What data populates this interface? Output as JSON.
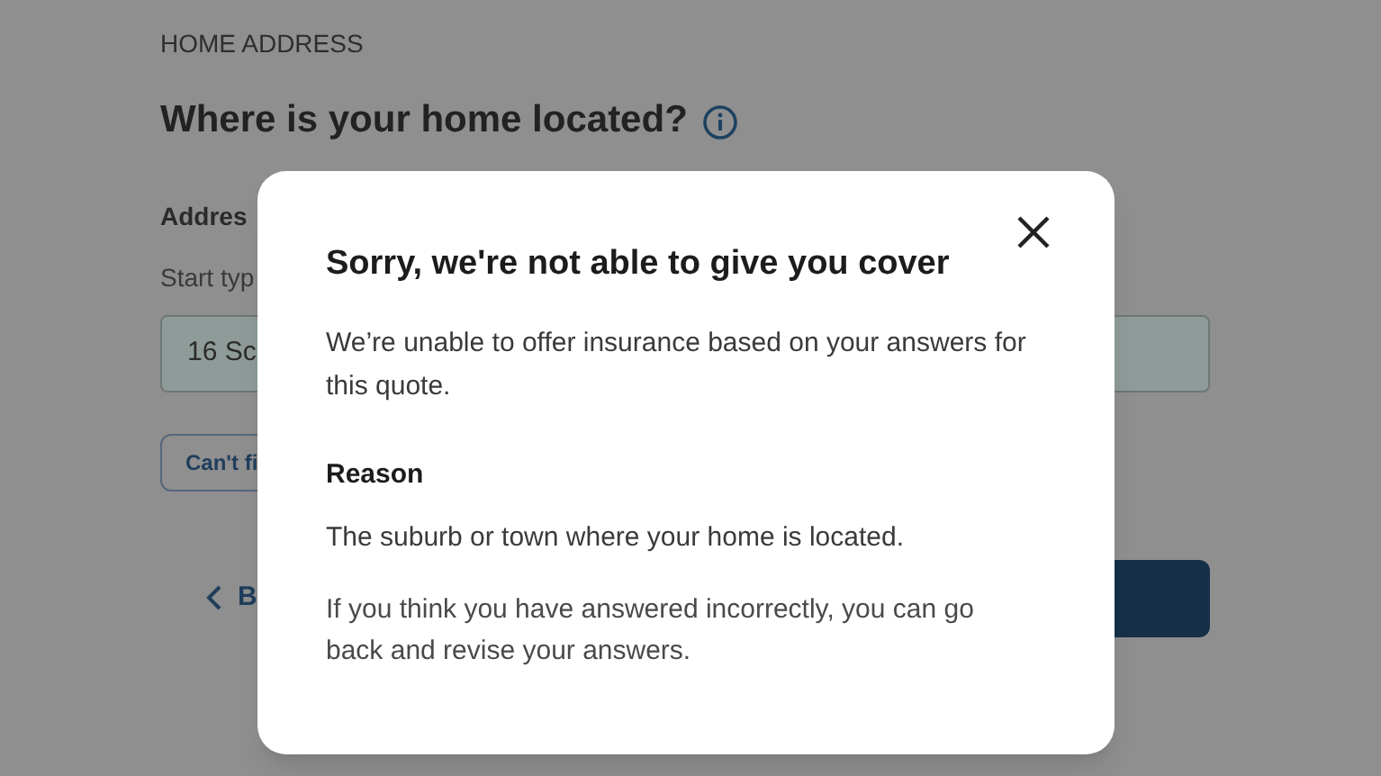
{
  "page": {
    "section_label": "HOME ADDRESS",
    "title": "Where is your home located?",
    "address_label": "Addres",
    "address_hint": "Start typ",
    "address_value": "16 Sc",
    "cant_find_button": "Can't fi",
    "back_link": "B"
  },
  "dialog": {
    "title": "Sorry, we're not able to give you cover",
    "message": "We’re unable to offer insurance based on your answers for this quote.",
    "reason_heading": "Reason",
    "reason": "The suburb or town where your home is located.",
    "advice": "If you think you have answered incorrectly, you can go back and revise your answers."
  }
}
